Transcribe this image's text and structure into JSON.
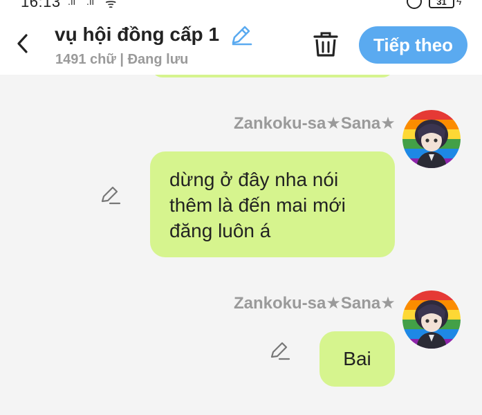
{
  "status_bar": {
    "time": "16:13",
    "battery": "31"
  },
  "header": {
    "title": "vụ hội đồng cấp 1",
    "subtitle": "1491 chữ | Đang lưu",
    "next_label": "Tiếp theo",
    "icons": [
      "back-icon",
      "pencil-icon",
      "trash-icon"
    ]
  },
  "messages": [
    {
      "sender": "Zankoku-sa★Sana★",
      "text": "dừng ở đây nha nói thêm là đến mai mới đăng luôn á",
      "lines": [
        "dừng ở đây nha nói",
        "thêm là đến mai mới",
        "đăng luôn á"
      ]
    },
    {
      "sender": "Zankoku-sa★Sana★",
      "text": "Bai",
      "lines": [
        "Bai"
      ]
    }
  ],
  "colors": {
    "accent": "#5aaaf0",
    "bubble": "#d6f48e",
    "background": "#f4f4f4",
    "muted_text": "#9a9a9a"
  }
}
